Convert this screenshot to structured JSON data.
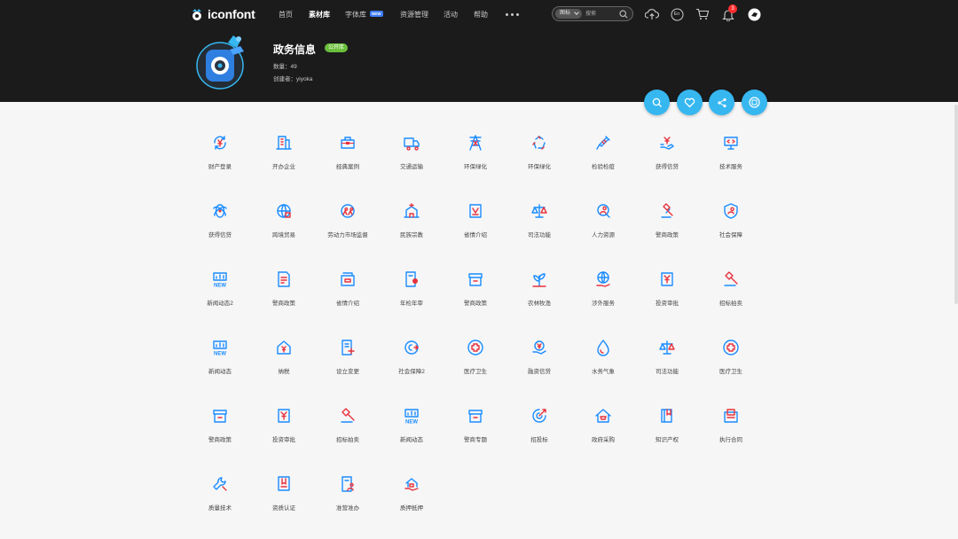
{
  "header": {
    "brand": "iconfont",
    "nav": [
      "首页",
      "素材库",
      "字体库",
      "资源管理",
      "活动",
      "帮助"
    ],
    "active_nav": "素材库",
    "new_badge": "NEW",
    "search_type": "图标",
    "search_placeholder": "搜索",
    "lang_label": "En",
    "notification_count": "3"
  },
  "library": {
    "title": "政务信息",
    "badge": "公开库",
    "count_label": "数量：49",
    "creator_label": "创建者：yiyoka"
  },
  "colors": {
    "blue": "#1a8cff",
    "red": "#e8323c",
    "accent": "#36b7f0",
    "header_bg": "#1b1b1c"
  },
  "icons": [
    {
      "label": "财产登录",
      "icon": "yen-cycle-icon"
    },
    {
      "label": "开办企业",
      "icon": "building-icon"
    },
    {
      "label": "经典案例",
      "icon": "briefcase-icon"
    },
    {
      "label": "交通运输",
      "icon": "truck-icon"
    },
    {
      "label": "环保绿化",
      "icon": "tower-icon"
    },
    {
      "label": "环保绿化",
      "icon": "recycle-icon"
    },
    {
      "label": "检验检疫",
      "icon": "syringe-icon"
    },
    {
      "label": "获得信贷",
      "icon": "money-hand-icon"
    },
    {
      "label": "技术服务",
      "icon": "monitor-code-icon"
    },
    {
      "label": "获得信贷",
      "icon": "atom-icon"
    },
    {
      "label": "跨境贸易",
      "icon": "globe-icon"
    },
    {
      "label": "劳动力市场监督",
      "icon": "workers-icon"
    },
    {
      "label": "民族宗教",
      "icon": "temple-icon"
    },
    {
      "label": "省情介绍",
      "icon": "map-doc-icon"
    },
    {
      "label": "司法功能",
      "icon": "scale-icon"
    },
    {
      "label": "人力资源",
      "icon": "person-search-icon"
    },
    {
      "label": "警商政策",
      "icon": "gavel-icon"
    },
    {
      "label": "社会保障",
      "icon": "shield-user-icon"
    },
    {
      "label": "新闻动态2",
      "icon": "news-chart-icon"
    },
    {
      "label": "警商政策",
      "icon": "document-icon"
    },
    {
      "label": "省情介绍",
      "icon": "cabinet-icon"
    },
    {
      "label": "年检年审",
      "icon": "doc-stamp-icon"
    },
    {
      "label": "警商政策",
      "icon": "archive-icon"
    },
    {
      "label": "农林牧渔",
      "icon": "plant-icon"
    },
    {
      "label": "涉外服务",
      "icon": "globe-hand-icon"
    },
    {
      "label": "投资审批",
      "icon": "yen-doc-icon"
    },
    {
      "label": "招标拍卖",
      "icon": "hammer-icon"
    },
    {
      "label": "新闻动态",
      "icon": "news-chart-icon"
    },
    {
      "label": "纳税",
      "icon": "house-yen-icon"
    },
    {
      "label": "设立变更",
      "icon": "doc-plus-icon"
    },
    {
      "label": "社会保障2",
      "icon": "target-hand-icon"
    },
    {
      "label": "医疗卫生",
      "icon": "medical-cross-icon"
    },
    {
      "label": "融资信贷",
      "icon": "yen-hand-icon"
    },
    {
      "label": "水务气象",
      "icon": "drop-icon"
    },
    {
      "label": "司法功能",
      "icon": "scale-icon"
    },
    {
      "label": "医疗卫生",
      "icon": "medical-cross-icon"
    },
    {
      "label": "警商政策",
      "icon": "archive-icon"
    },
    {
      "label": "投资审批",
      "icon": "yen-doc-icon"
    },
    {
      "label": "招标拍卖",
      "icon": "hammer-icon"
    },
    {
      "label": "新闻动态",
      "icon": "news-chart-icon"
    },
    {
      "label": "警商专题",
      "icon": "archive-icon"
    },
    {
      "label": "招投标",
      "icon": "target-icon"
    },
    {
      "label": "政府采购",
      "icon": "house-cart-icon"
    },
    {
      "label": "知识产权",
      "icon": "book-icon"
    },
    {
      "label": "执行合同",
      "icon": "contract-icon"
    },
    {
      "label": "质量技术",
      "icon": "wrench-icon"
    },
    {
      "label": "资质认证",
      "icon": "certificate-icon"
    },
    {
      "label": "准营准办",
      "icon": "doc-user-icon"
    },
    {
      "label": "质押抵押",
      "icon": "house-hand-icon"
    }
  ]
}
